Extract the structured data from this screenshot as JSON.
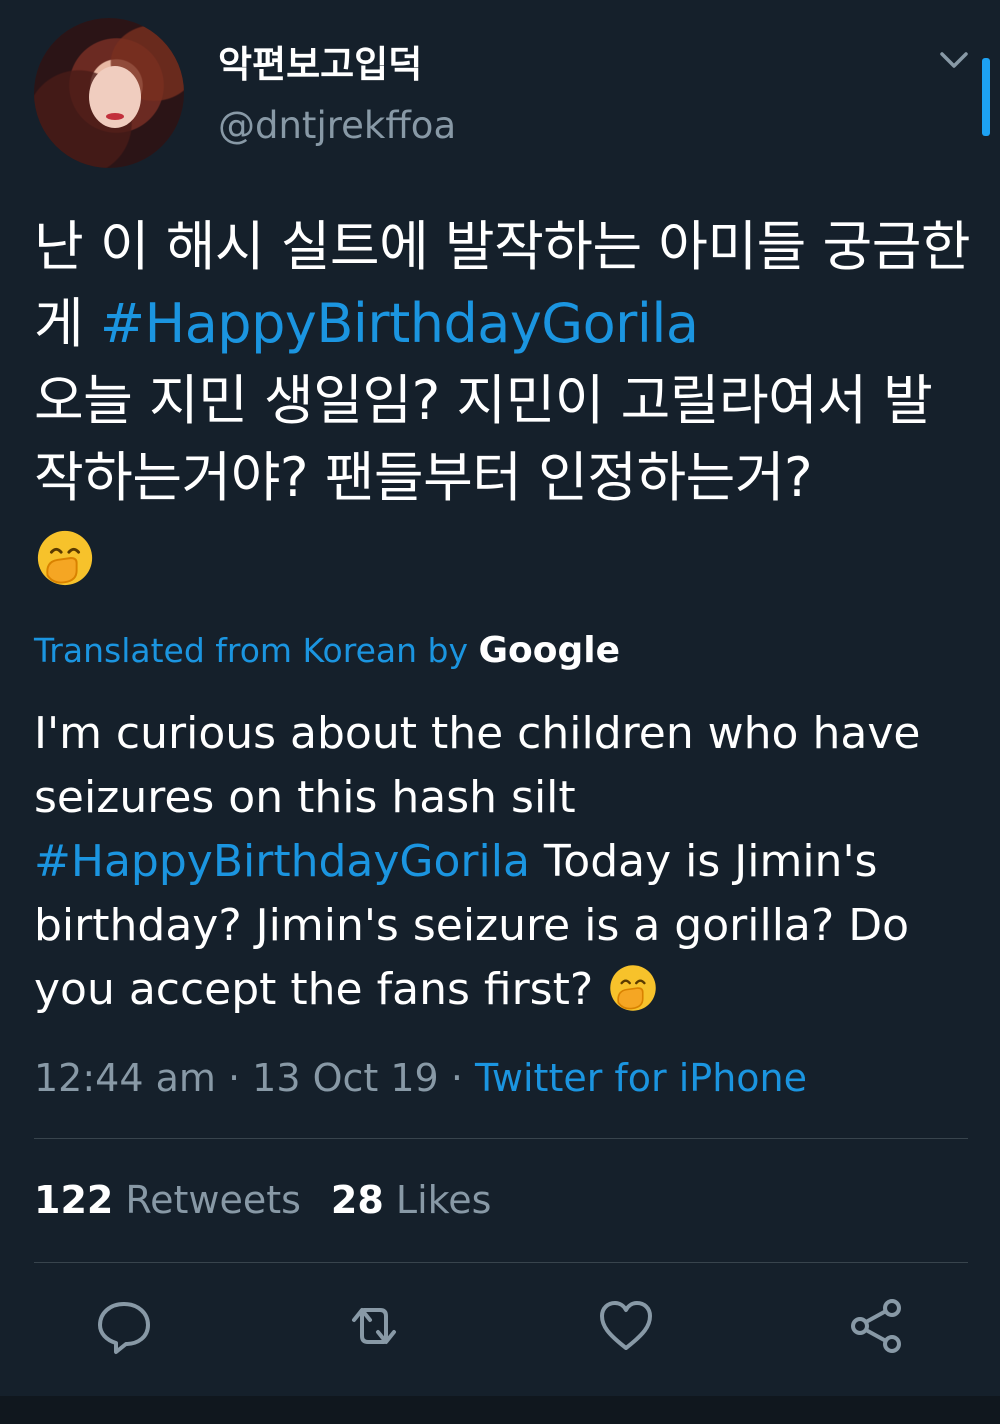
{
  "user": {
    "display_name": "악편보고입덕",
    "handle": "@dntjrekffoa"
  },
  "tweet": {
    "text_part1": "난 이 해시 실트에 발작하는 아미들 궁금한게 ",
    "hashtag": "#HappyBirthdayGorila",
    "text_part2": "오늘 지민 생일임? 지민이 고릴라여서 발작하는거야? 팬들부터 인정하는거?",
    "emoji": "hand-over-mouth-emoji"
  },
  "translation": {
    "label": "Translated from Korean by ",
    "provider": "Google",
    "text_part1": "I'm curious about the children who have seizures on this hash silt ",
    "hashtag": "#HappyBirthdayGorila",
    "text_part2": " Today is Jimin's birthday? Jimin's seizure is a gorilla? Do you accept the fans first? "
  },
  "meta": {
    "time": "12:44 am",
    "separator": " · ",
    "date": "13 Oct 19",
    "separator2": " · ",
    "source": "Twitter for iPhone"
  },
  "stats": {
    "retweets_count": "122",
    "retweets_label": " Retweets",
    "likes_count": "28",
    "likes_label": " Likes"
  },
  "actions": [
    "reply-icon",
    "retweet-icon",
    "like-icon",
    "share-icon"
  ],
  "colors": {
    "background": "#15202b",
    "accent": "#1b95e0",
    "secondary_text": "#8899a6",
    "divider": "#38444d"
  }
}
